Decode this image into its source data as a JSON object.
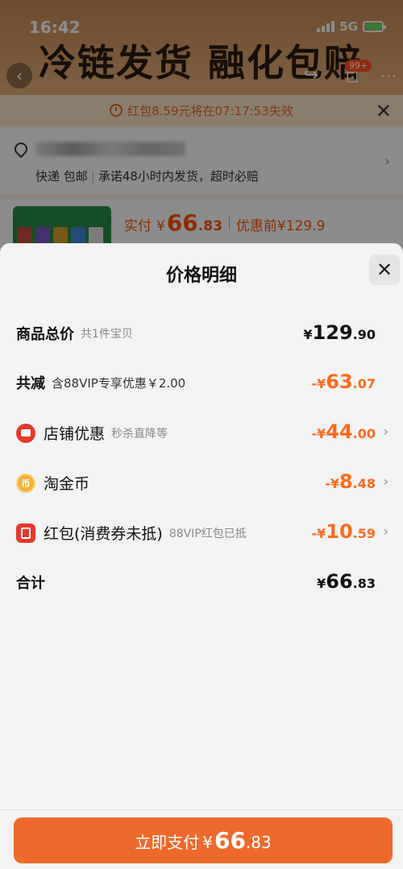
{
  "status_bar": {
    "time": "16:42",
    "network": "5G"
  },
  "banner": {
    "title": "冷链发货 融化包赔",
    "cart_badge": "99+"
  },
  "redpacket_bar": {
    "text": "红包8.59元将在07:17:53失效"
  },
  "address": {
    "delivery": "快递 包邮",
    "promise": "承诺48小时内发货，超时必赔"
  },
  "product": {
    "paid_label": "实付",
    "currency": "¥",
    "price_int": "66",
    "price_dec": ".83",
    "original": "优惠前¥129.9"
  },
  "sheet": {
    "title": "价格明细",
    "rows": [
      {
        "label": "商品总价",
        "sub": "共1件宝贝",
        "currency": "¥",
        "int": "129",
        "dec": ".90"
      },
      {
        "label": "共减",
        "sub": "含88VIP专享优惠￥2.00",
        "currency": "-¥",
        "int": "63",
        "dec": ".07"
      },
      {
        "label": "店铺优惠",
        "sub": "秒杀直降等",
        "currency": "-¥",
        "int": "44",
        "dec": ".00"
      },
      {
        "label": "淘金币",
        "sub": "",
        "currency": "-¥",
        "int": "8",
        "dec": ".48"
      },
      {
        "label": "红包(消费券未抵)",
        "sub": "88VIP红包已抵",
        "currency": "-¥",
        "int": "10",
        "dec": ".59"
      },
      {
        "label": "合计",
        "sub": "",
        "currency": "¥",
        "int": "66",
        "dec": ".83"
      }
    ],
    "coin_glyph": "币"
  },
  "pay_button": {
    "label": "立即支付",
    "currency": "¥",
    "int": "66",
    "dec": ".83"
  },
  "colors": {
    "accent": "#ee6a2c",
    "discount": "#ff6a1f",
    "shop_red": "#e8372b",
    "coin": "#f6b03a"
  },
  "icons": [
    "chevron-left-icon",
    "share-icon",
    "cart-icon",
    "more-icon",
    "clock-icon",
    "close-icon",
    "location-icon",
    "chevron-right-icon",
    "shop-icon",
    "coin-icon",
    "red-packet-icon"
  ]
}
